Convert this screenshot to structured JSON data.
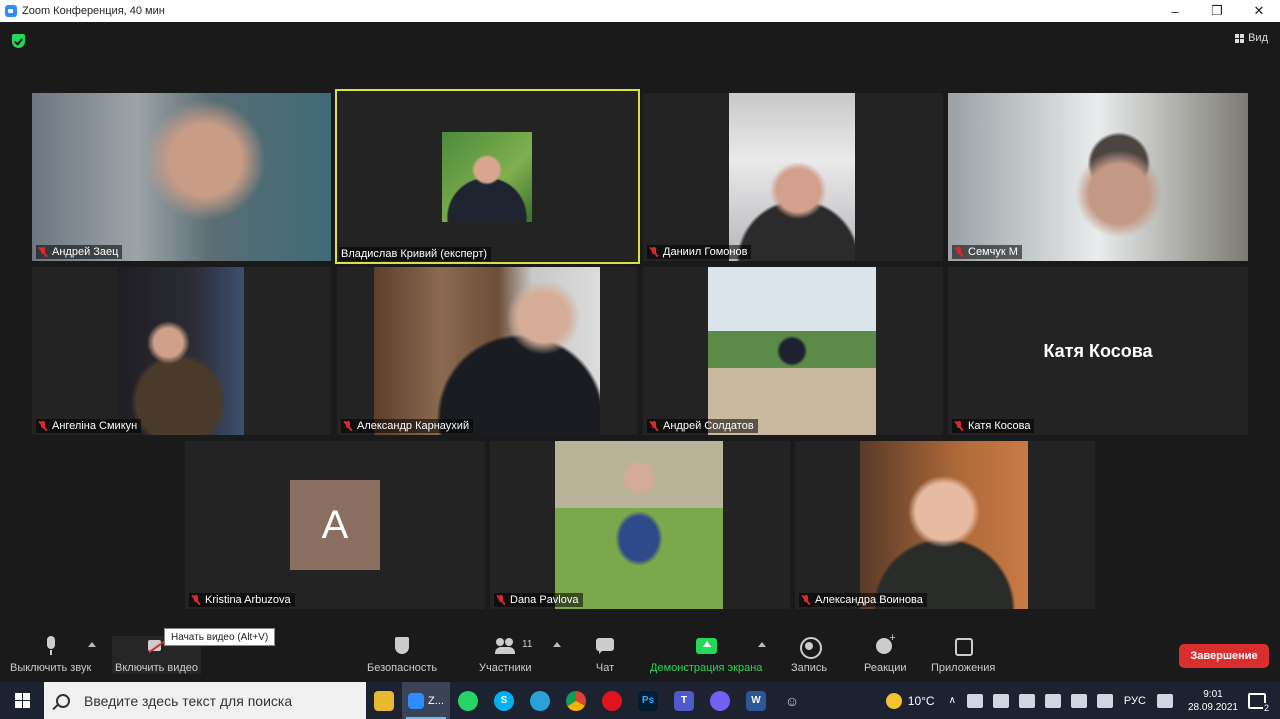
{
  "window": {
    "title": "Zoom Конференция, 40 мин",
    "minimize": "–",
    "maximize": "❐",
    "close": "✕"
  },
  "meeting": {
    "view_label": "Вид",
    "participants": [
      {
        "name": "Андрей Заец",
        "muted": true
      },
      {
        "name": "Владислав Кривий (експерт)",
        "muted": false,
        "active_speaker": true
      },
      {
        "name": "Даниил Гомонов",
        "muted": true
      },
      {
        "name": "Семчук М",
        "muted": true
      },
      {
        "name": "Ангеліна Смикун",
        "muted": true
      },
      {
        "name": "Александр Карнаухий",
        "muted": true
      },
      {
        "name": "Андрей Солдатов",
        "muted": true
      },
      {
        "name": "Катя Косова",
        "muted": true,
        "center_name": "Катя Косова"
      },
      {
        "name": "Kristina Arbuzova",
        "muted": true,
        "avatar_letter": "A"
      },
      {
        "name": "Dana Pavlova",
        "muted": true
      },
      {
        "name": "Александра Воинова",
        "muted": true
      }
    ]
  },
  "toolbar": {
    "mute": "Выключить звук",
    "video": "Включить видео",
    "security": "Безопасность",
    "participants": "Участники",
    "participants_count": "11",
    "chat": "Чат",
    "share": "Демонстрация экрана",
    "record": "Запись",
    "reactions": "Реакции",
    "apps": "Приложения",
    "end": "Завершение",
    "tooltip": "Начать видео (Alt+V)"
  },
  "taskbar": {
    "search_placeholder": "Введите здесь текст для поиска",
    "zoom_label": "Z...",
    "weather": "10°C",
    "lang": "РУС",
    "time": "9:01",
    "date": "28.09.2021",
    "notifications": "2"
  },
  "colors": {
    "accent_green": "#23d959",
    "active_speaker": "#d8e04a",
    "end_button": "#d92e2e",
    "muted_icon": "#e02828"
  }
}
